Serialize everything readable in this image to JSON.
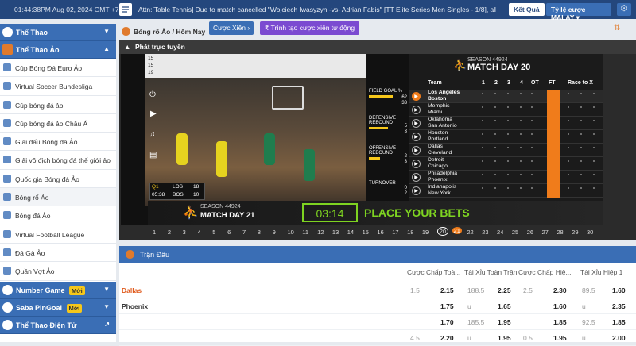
{
  "topbar": {
    "time": "01:44:38PM Aug 02, 2024 GMT +7",
    "announcement": "Attn:[Table Tennis] Due to match cancelled \"Wojciech Iwasyzyn -vs- Adrian Fabis\" [TT Elite Series Men Singles - 1/8], all",
    "result_button": "Kết Quả",
    "odds_button": "Tỷ lệ cược MALAY"
  },
  "sidebar": {
    "sports_label": "Thể Thao",
    "virtual_label": "Thể Thao Ảo",
    "items": [
      "Cúp Bóng Đá Euro Ảo",
      "Virtual Soccer Bundesliga",
      "Cúp bóng đá ảo",
      "Cúp bóng đá ảo Châu Á",
      "Giải đấu Bóng đá Ảo",
      "Giải vô địch bóng đá thế giới ảo",
      "Quốc gia Bóng đá Ảo",
      "Bóng rổ Ảo",
      "Bóng đá Ảo",
      "Virtual Football League",
      "Đá Gà Ảo",
      "Quần Vợt Ảo"
    ],
    "number_game": "Number Game",
    "saba_pingoal": "Saba PinGoal",
    "new_badge": "Mới",
    "esports": "Thể Thao Điện Tử"
  },
  "breadcrumb": {
    "text": "Bóng rổ Ảo / Hôm Nay",
    "parlay_button": "Cược Xiên",
    "auto_parlay_button": "Trình tạo cược xiên tự động"
  },
  "live": {
    "title": "Phát trực tuyến",
    "season": "SEASON 44924",
    "matchday_top": "MATCH DAY 20",
    "matchday_bottom": "MATCH DAY 21",
    "timer": "03:14",
    "place_bets": "PLACE YOUR BETS",
    "stats": [
      "FIELD GOAL %",
      "DEFENSIVE REBOUND",
      "OFFENSIVE REBOUND",
      "TURNOVER"
    ],
    "stat_values": [
      [
        "62",
        "33"
      ],
      [
        "5",
        "3"
      ],
      [
        "2",
        "3"
      ],
      [
        "0",
        "2"
      ]
    ],
    "score_rows": [
      [
        "15",
        "15"
      ],
      [
        "19",
        ""
      ]
    ],
    "overlay_score": {
      "q": "Q1",
      "clock": "05:38",
      "t1": "LOS",
      "s1": "18",
      "t2": "BOS",
      "s2": "10"
    },
    "sb_headers": [
      "Team",
      "1",
      "2",
      "3",
      "4",
      "OT",
      "FT",
      "Race to X"
    ],
    "teams": [
      [
        "Los Angeles",
        "Boston"
      ],
      [
        "Memphis",
        "Miami"
      ],
      [
        "Oklahoma",
        "San Antonio"
      ],
      [
        "Houston",
        "Portland"
      ],
      [
        "Dallas",
        "Cleveland"
      ],
      [
        "Detroit",
        "Chicago"
      ],
      [
        "Philadelphia",
        "Phoenix"
      ],
      [
        "Indianapolis",
        "New York"
      ]
    ],
    "matchdays": [
      "1",
      "2",
      "3",
      "4",
      "5",
      "6",
      "7",
      "8",
      "9",
      "10",
      "11",
      "12",
      "13",
      "14",
      "15",
      "16",
      "17",
      "18",
      "19",
      "20",
      "21",
      "22",
      "23",
      "24",
      "25",
      "26",
      "27",
      "28",
      "29",
      "30"
    ],
    "current_matchday": "21",
    "circled_matchday": "20"
  },
  "matches": {
    "title": "Trận Đấu",
    "columns": [
      "Cược Chấp Toà...",
      "Tài Xỉu Toàn Trận",
      "Cược Chấp Hiệ...",
      "Tài Xỉu Hiệp 1"
    ],
    "rows": [
      {
        "team": "Dallas",
        "cells": [
          "1.5",
          "2.15",
          "188.5",
          "2.25",
          "2.5",
          "2.30",
          "89.5",
          "1.60"
        ]
      },
      {
        "team": "Phoenix",
        "cells": [
          "",
          "1.75",
          "u",
          "1.65",
          "",
          "1.60",
          "u",
          "2.35"
        ]
      },
      {
        "team": "",
        "cells": [
          "",
          "1.70",
          "185.5",
          "1.95",
          "",
          "1.85",
          "92.5",
          "1.85"
        ]
      },
      {
        "team": "",
        "cells": [
          "4.5",
          "2.20",
          "u",
          "1.95",
          "0.5",
          "1.95",
          "u",
          "2.00"
        ]
      }
    ]
  },
  "colors": {
    "header_blue": "#24477d",
    "section_blue": "#3a6eb5",
    "accent_orange": "#f07c1b",
    "bets_green": "#7ed321"
  }
}
